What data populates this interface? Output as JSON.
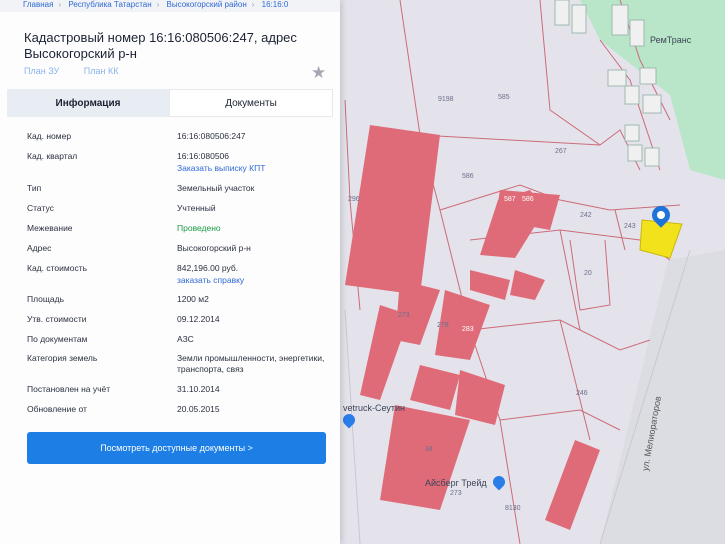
{
  "breadcrumb": {
    "items": [
      "Главная",
      "Республика Татарстан",
      "Высокогорский район",
      "16:16:0"
    ]
  },
  "title": "Кадастровый номер 16:16:080506:247, адрес Высокогорский р-н",
  "plan_links": {
    "plan_zu": "План ЗУ",
    "plan_kk": "План КК"
  },
  "tabs": {
    "info": "Информация",
    "documents": "Документы"
  },
  "properties": [
    {
      "key": "Кад. номер",
      "value": "16:16:080506:247"
    },
    {
      "key": "Кад. квартал",
      "value": "16:16:080506",
      "link": "Заказать выписку КПТ"
    },
    {
      "key": "Тип",
      "value": "Земельный участок"
    },
    {
      "key": "Статус",
      "value": "Учтенный"
    },
    {
      "key": "Межевание",
      "value": "Проведено"
    },
    {
      "key": "Адрес",
      "value": "Высокогорский р-н"
    },
    {
      "key": "Кад. стоимость",
      "value": "842,196.00 руб.",
      "link": "заказать справку"
    },
    {
      "key": "Площадь",
      "value": "1200 м2"
    },
    {
      "key": "Утв. стоимости",
      "value": "09.12.2014"
    },
    {
      "key": "По документам",
      "value": "АЗС"
    },
    {
      "key": "Категория земель",
      "value": "Земли промышленности, энергетики, транспорта, связ"
    },
    {
      "key": "Постановлен на учёт",
      "value": "31.10.2014"
    },
    {
      "key": "Обновление от",
      "value": "20.05.2015"
    }
  ],
  "docs_button": "Посмотреть доступные документы >",
  "map": {
    "parcels": [
      "9198",
      "585",
      "267",
      "586",
      "587",
      "586",
      "242",
      "243",
      "20",
      "296",
      "273",
      "278",
      "283",
      "246",
      "34",
      "8130",
      "273"
    ],
    "poi": {
      "remtrans": "РемТранс",
      "vetruck": "vetruck-Сеутин",
      "aisbergtreid": "Айсберг Трейд"
    },
    "road": "ул. Мелиораторов"
  },
  "colors": {
    "accent": "#1d7ee6",
    "green": "#1b9a44",
    "building": "#e06b78",
    "selected": "#f2e21b"
  }
}
